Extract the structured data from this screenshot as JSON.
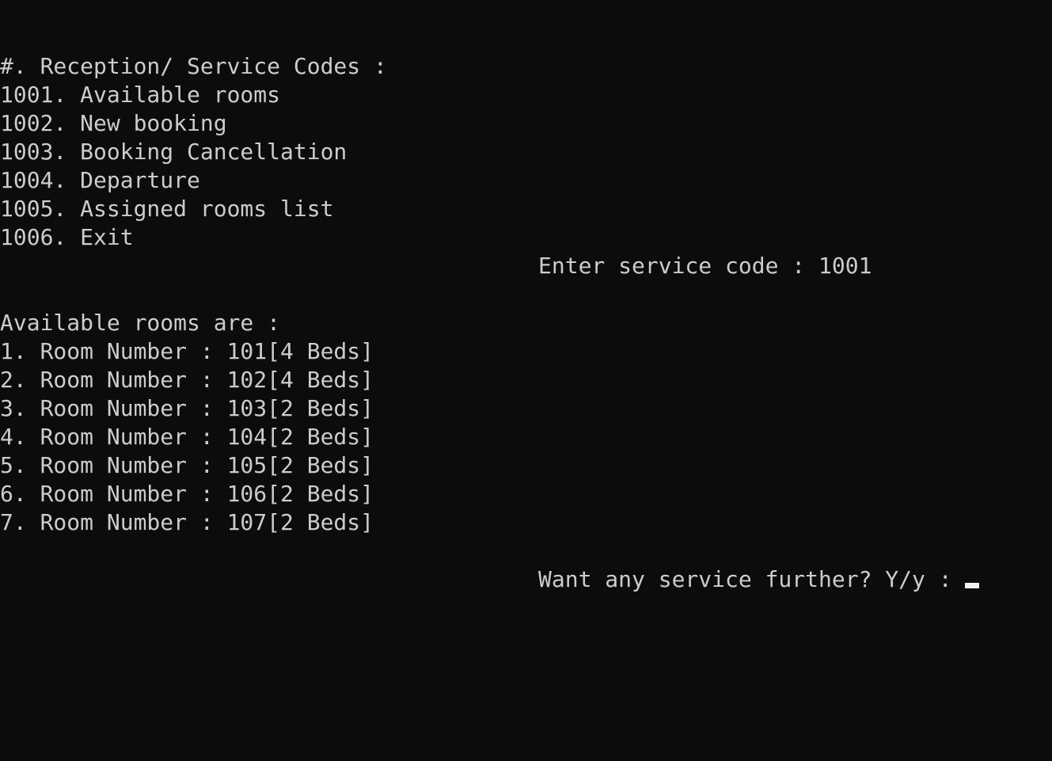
{
  "menu": {
    "header": "#. Reception/ Service Codes :",
    "items": [
      "1001. Available rooms",
      "1002. New booking",
      "1003. Booking Cancellation",
      "1004. Departure",
      "1005. Assigned rooms list",
      "1006. Exit"
    ]
  },
  "prompt": {
    "label": "Enter service code : ",
    "value": "1001"
  },
  "result": {
    "header": "Available rooms are :",
    "rooms": [
      "1. Room Number : 101[4 Beds]",
      "2. Room Number : 102[4 Beds]",
      "3. Room Number : 103[2 Beds]",
      "4. Room Number : 104[2 Beds]",
      "5. Room Number : 105[2 Beds]",
      "6. Room Number : 106[2 Beds]",
      "7. Room Number : 107[2 Beds]"
    ]
  },
  "continue_prompt": {
    "label": "Want any service further? Y/y : "
  },
  "colors": {
    "background": "#0c0c0c",
    "text": "#cccccc",
    "cursor": "#f2f2f2"
  }
}
